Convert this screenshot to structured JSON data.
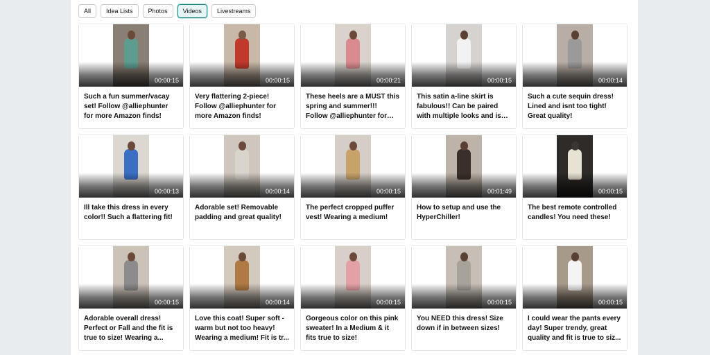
{
  "filters": {
    "items": [
      {
        "label": "All",
        "active": false
      },
      {
        "label": "Idea Lists",
        "active": false
      },
      {
        "label": "Photos",
        "active": false
      },
      {
        "label": "Videos",
        "active": true
      },
      {
        "label": "Livestreams",
        "active": false
      }
    ]
  },
  "videos": [
    {
      "duration": "00:00:15",
      "caption": "Such a fun summer/vacay set! Follow @alliephunter for more Amazon finds!",
      "bg": "#8a7f74",
      "body": "#5e9c90",
      "head": "#6b4a3a"
    },
    {
      "duration": "00:00:15",
      "caption": "Very flattering 2-piece! Follow @alliephunter for more Amazon finds!",
      "bg": "#c8b8a8",
      "body": "#c0392b",
      "head": "#7a5a48"
    },
    {
      "duration": "00:00:21",
      "caption": "These heels are a MUST this spring and summer!!! Follow @alliephunter for more...",
      "bg": "#d9d3cc",
      "body": "#d98b8f",
      "head": "#6b4a3a"
    },
    {
      "duration": "00:00:15",
      "caption": "This satin a-line skirt is fabulous!! Can be paired with multiple looks and is lined!",
      "bg": "#d6d2cf",
      "body": "#f2f2f2",
      "head": "#5a3f33"
    },
    {
      "duration": "00:00:14",
      "caption": "Such a cute sequin dress! Lined and isnt too tight! Great quality!",
      "bg": "#b8aea5",
      "body": "#9a9a9a",
      "head": "#5a3f33"
    },
    {
      "duration": "00:00:13",
      "caption": "Ill take this dress in every color!! Such a flattering fit!",
      "bg": "#dcd7d0",
      "body": "#3b6fc4",
      "head": "#6b4a3a"
    },
    {
      "duration": "00:00:14",
      "caption": "Adorable set! Removable padding and great quality!",
      "bg": "#cfc7bd",
      "body": "#d9d4cc",
      "head": "#6b4a3a"
    },
    {
      "duration": "00:00:15",
      "caption": "The perfect cropped puffer vest! Wearing a medium!",
      "bg": "#d5cec6",
      "body": "#c7a36a",
      "head": "#6b4a3a"
    },
    {
      "duration": "00:01:49",
      "caption": "How to setup and use the HyperChiller!",
      "bg": "#bdb3a8",
      "body": "#3a302b",
      "head": "#5a3f33"
    },
    {
      "duration": "00:00:15",
      "caption": "The best remote controlled candles! You need these!",
      "bg": "#2e2b28",
      "body": "#e8e2d2",
      "head": "#3a3632"
    },
    {
      "duration": "00:00:15",
      "caption": "Adorable overall dress! Perfect or Fall and the fit is true to size! Wearing a...",
      "bg": "#cbc2b8",
      "body": "#8c8c8c",
      "head": "#6b4a3a"
    },
    {
      "duration": "00:00:14",
      "caption": "Love this coat! Super soft - warm but not too heavy! Wearing a medium! Fit is tr...",
      "bg": "#d3c9bd",
      "body": "#b07a45",
      "head": "#6b4a3a"
    },
    {
      "duration": "00:00:15",
      "caption": "Gorgeous color on this pink sweater! In a Medium & it fits true to size!",
      "bg": "#d8d0c8",
      "body": "#e3a0a6",
      "head": "#6b4a3a"
    },
    {
      "duration": "00:00:15",
      "caption": "You NEED this dress! Size down if in between sizes!",
      "bg": "#c7bfb6",
      "body": "#a8a39a",
      "head": "#5a3f33"
    },
    {
      "duration": "00:00:15",
      "caption": "I could wear the pants every day! Super trendy, great quality and fit is true to siz...",
      "bg": "#a89a8a",
      "body": "#f4f4f4",
      "head": "#5a3f33"
    }
  ]
}
